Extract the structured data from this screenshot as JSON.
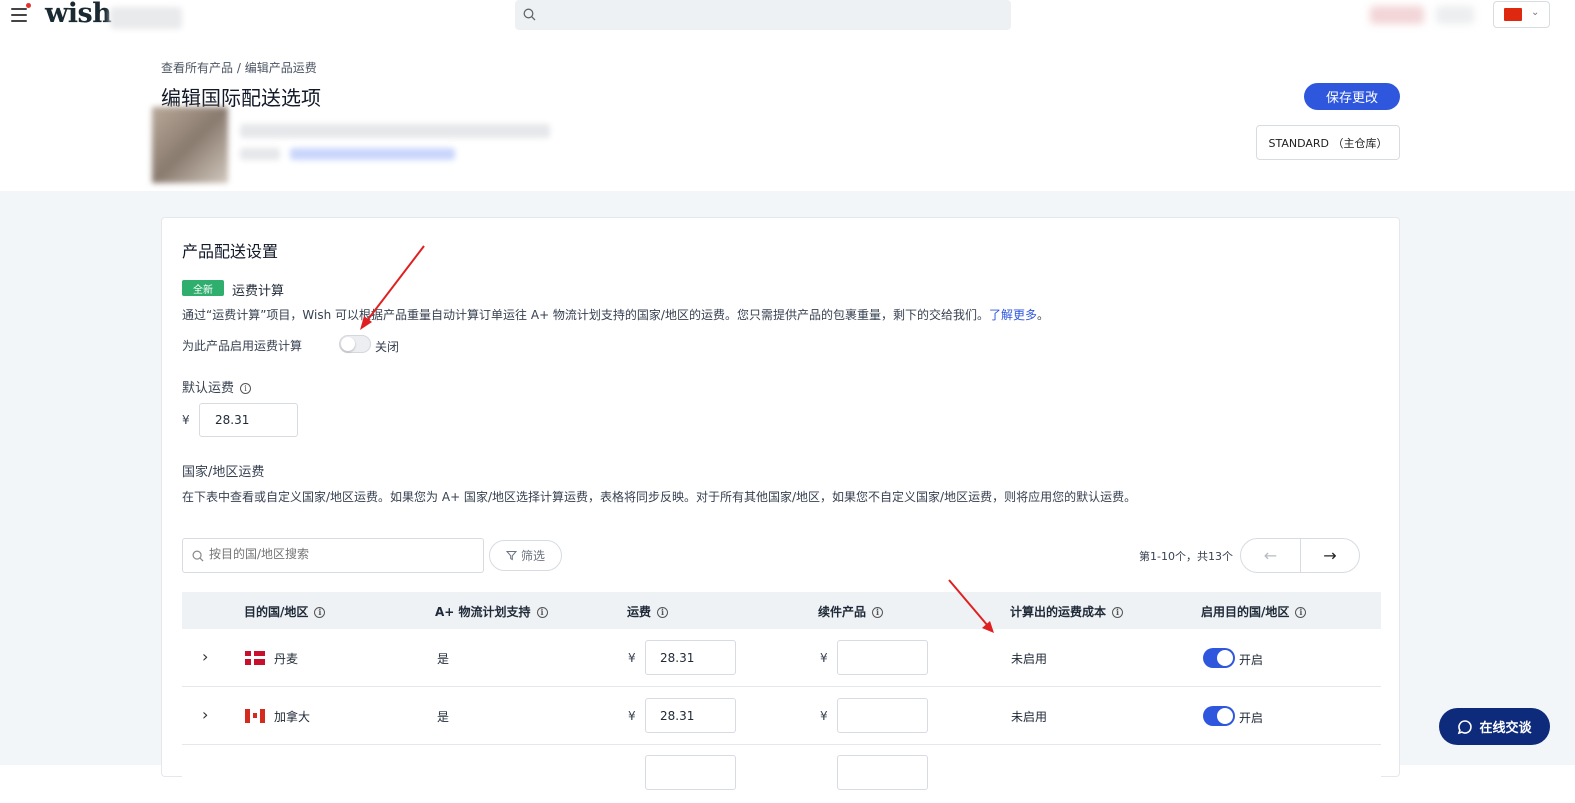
{
  "topbar": {
    "logo": "wish",
    "search_placeholder": ""
  },
  "header": {
    "breadcrumb": [
      "查看所有产品",
      "编辑产品运费"
    ],
    "breadcrumb_sep": " / ",
    "title": "编辑国际配送选项",
    "save_label": "保存更改",
    "warehouse_label": "STANDARD （主仓库）"
  },
  "settings": {
    "section_title": "产品配送设置",
    "new_badge": "全新",
    "calc_label": "运费计算",
    "description": "通过“运费计算”项目，Wish 可以根据产品重量自动计算订单运往 A+ 物流计划支持的国家/地区的运费。您只需提供产品的包裹重量，剩下的交给我们。",
    "learn_more": "了解更多",
    "period": "。",
    "enable_label": "为此产品启用运费计算",
    "enable_state": "关闭",
    "default_fee_label": "默认运费",
    "currency": "¥",
    "default_fee_value": "28.31"
  },
  "country": {
    "title": "国家/地区运费",
    "description": "在下表中查看或自定义国家/地区运费。如果您为 A+ 国家/地区选择计算运费，表格将同步反映。对于所有其他国家/地区，如果您不自定义国家/地区运费，则将应用您的默认运费。",
    "search_placeholder": "按目的国/地区搜索",
    "filter_label": "筛选",
    "page_info": "第1-10个，共13个",
    "columns": [
      "目的国/地区",
      "A+ 物流计划支持",
      "运费",
      "续件产品",
      "计算出的运费成本",
      "启用目的国/地区"
    ],
    "rows": [
      {
        "name": "丹麦",
        "aplus": "是",
        "currency": "¥",
        "fee": "28.31",
        "calc": "未启用",
        "status": "开启"
      },
      {
        "name": "加拿大",
        "aplus": "是",
        "currency": "¥",
        "fee": "28.31",
        "calc": "未启用",
        "status": "开启"
      }
    ]
  },
  "chat": {
    "label": "在线交谈"
  },
  "colors": {
    "primary": "#2f57de",
    "new_badge": "#2fae6e",
    "chat": "#0e2a7a",
    "annotation_arrow": "#e02020"
  }
}
